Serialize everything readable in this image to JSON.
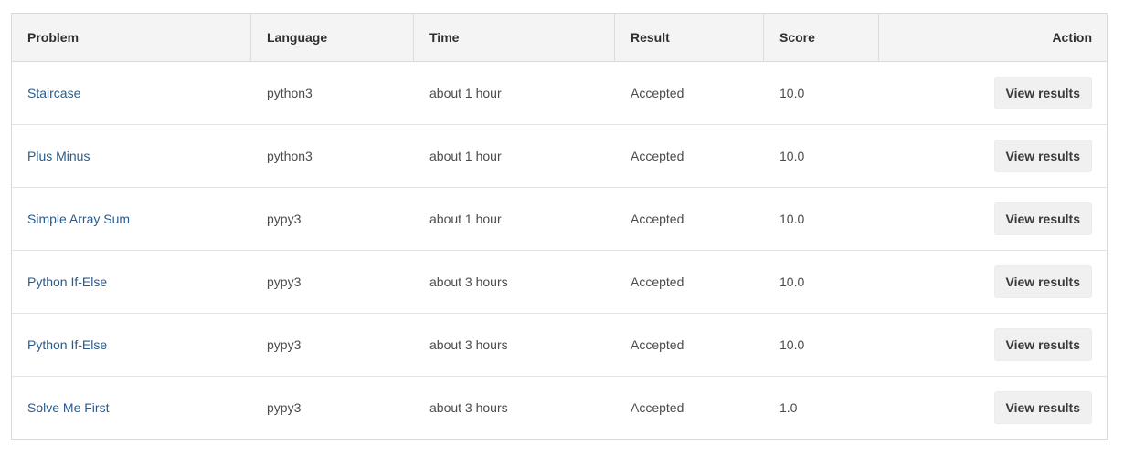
{
  "table": {
    "headers": {
      "problem": "Problem",
      "language": "Language",
      "time": "Time",
      "result": "Result",
      "score": "Score",
      "action": "Action"
    },
    "rows": [
      {
        "problem": "Staircase",
        "language": "python3",
        "time": "about 1 hour",
        "result": "Accepted",
        "score": "10.0",
        "action": "View results"
      },
      {
        "problem": "Plus Minus",
        "language": "python3",
        "time": "about 1 hour",
        "result": "Accepted",
        "score": "10.0",
        "action": "View results"
      },
      {
        "problem": "Simple Array Sum",
        "language": "pypy3",
        "time": "about 1 hour",
        "result": "Accepted",
        "score": "10.0",
        "action": "View results"
      },
      {
        "problem": "Python If-Else",
        "language": "pypy3",
        "time": "about 3 hours",
        "result": "Accepted",
        "score": "10.0",
        "action": "View results"
      },
      {
        "problem": "Python If-Else",
        "language": "pypy3",
        "time": "about 3 hours",
        "result": "Accepted",
        "score": "10.0",
        "action": "View results"
      },
      {
        "problem": "Solve Me First",
        "language": "pypy3",
        "time": "about 3 hours",
        "result": "Accepted",
        "score": "1.0",
        "action": "View results"
      }
    ]
  },
  "colors": {
    "link": "#2a5b8c",
    "header_bg": "#f4f4f4",
    "button_bg": "#f0f0f0",
    "border": "#d9d9d9"
  }
}
